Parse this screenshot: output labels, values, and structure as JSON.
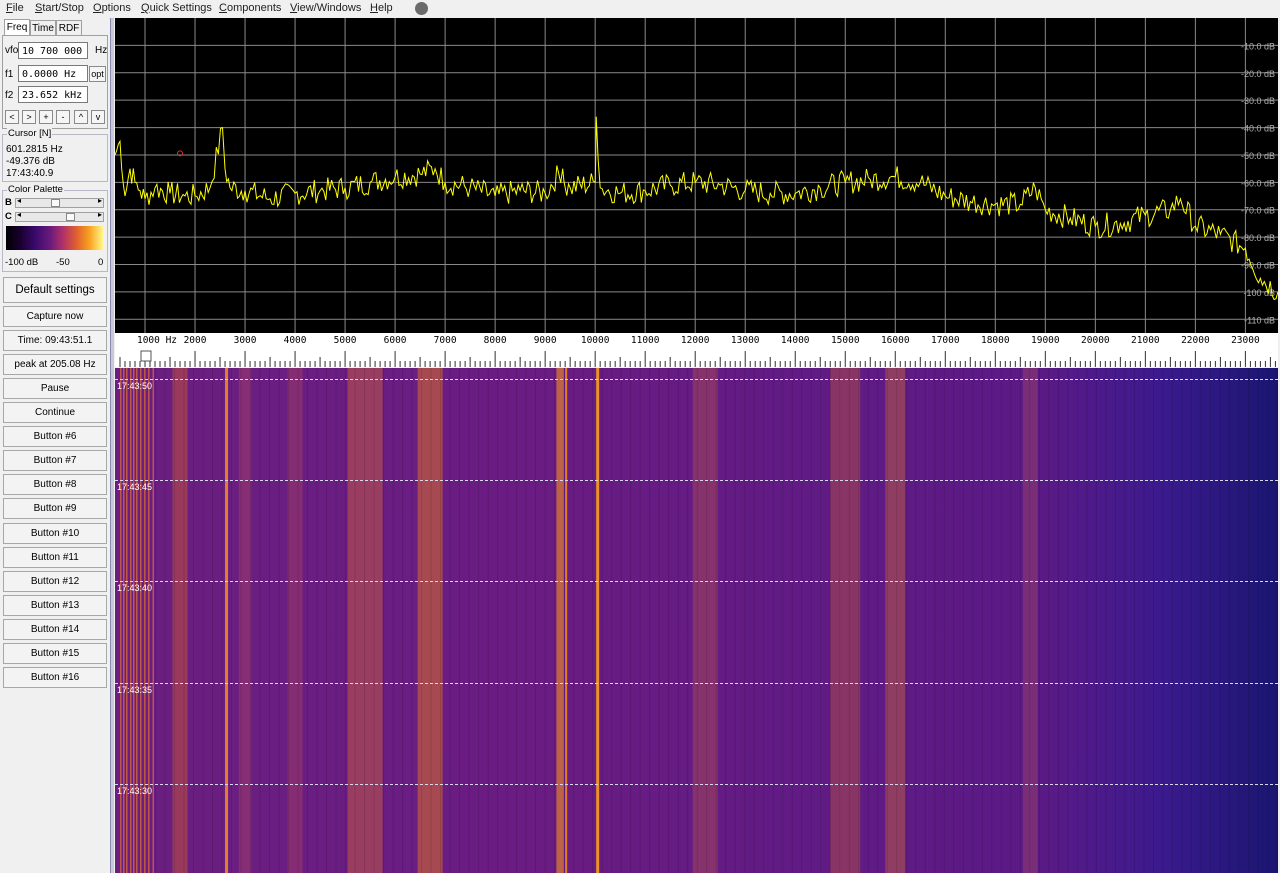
{
  "menu": [
    {
      "label": "File",
      "ul": "F"
    },
    {
      "label": "Start/Stop",
      "ul": "S"
    },
    {
      "label": "Options",
      "ul": "O"
    },
    {
      "label": "Quick Settings",
      "ul": "Q"
    },
    {
      "label": "Components",
      "ul": "C"
    },
    {
      "label": "View/Windows",
      "ul": "V"
    },
    {
      "label": "Help",
      "ul": "H"
    }
  ],
  "tabs": [
    "Freq",
    "Time",
    "RDF"
  ],
  "freq": {
    "vfo_label": "vfo",
    "vfo_value": "10 700 000",
    "vfo_unit": "Hz",
    "f1_label": "f1",
    "f1_value": "0.0000 Hz",
    "f1_btn": "opt",
    "f2_label": "f2",
    "f2_value": "23.652 kHz",
    "nav": [
      "<",
      ">",
      "+",
      "-",
      "^",
      "v"
    ]
  },
  "cursor": {
    "title": "Cursor [N]",
    "freq": "601.2815 Hz",
    "level": "-49.376 dB",
    "time": "17:43:40.9"
  },
  "palette": {
    "title": "Color Palette",
    "b_label": "B",
    "c_label": "C",
    "min": "-100 dB",
    "mid": "-50",
    "max": "0"
  },
  "buttons": {
    "default": "Default settings",
    "capture": "Capture now",
    "time": "Time:  09:43:51.1",
    "peak": "peak at 205.08 Hz",
    "pause": "Pause",
    "cont": "Continue",
    "b6": "Button #6",
    "b7": "Button #7",
    "b8": "Button #8",
    "b9": "Button #9",
    "b10": "Button #10",
    "b11": "Button #11",
    "b12": "Button #12",
    "b13": "Button #13",
    "b14": "Button #14",
    "b15": "Button #15",
    "b16": "Button #16"
  },
  "chart_data": {
    "type": "line",
    "title": "",
    "xlabel": "Hz",
    "ylabel": "dB",
    "xlim": [
      400,
      23652
    ],
    "ylim": [
      -115,
      0
    ],
    "x_ticks": [
      "1000 Hz",
      "2000",
      "3000",
      "4000",
      "5000",
      "6000",
      "7000",
      "8000",
      "9000",
      "10000",
      "11000",
      "12000",
      "13000",
      "14000",
      "15000",
      "16000",
      "17000",
      "18000",
      "19000",
      "20000",
      "21000",
      "22000",
      "23000"
    ],
    "y_ticks": [
      "-10.0 dB",
      "-20.0 dB",
      "-30.0 dB",
      "-40.0 dB",
      "-50.0 dB",
      "-60.0 dB",
      "-70.0 dB",
      "-80.0 dB",
      "-90.0 dB",
      "-100 dB",
      "-110 dB"
    ],
    "series": [
      {
        "color": "#ffff00",
        "values_x": [
          400,
          500,
          600,
          700,
          800,
          900,
          1000,
          1200,
          1500,
          1800,
          2000,
          2300,
          2550,
          2600,
          2700,
          3000,
          3500,
          4000,
          4500,
          5000,
          5500,
          6000,
          6500,
          6800,
          7000,
          7500,
          8000,
          8500,
          9000,
          9350,
          9400,
          9500,
          10000,
          10020,
          10100,
          10500,
          11000,
          11500,
          12000,
          12500,
          13000,
          13500,
          14000,
          14500,
          15000,
          15500,
          16000,
          16500,
          17000,
          17500,
          18000,
          18500,
          18800,
          19000,
          19500,
          20000,
          20500,
          21000,
          21500,
          21700,
          22000,
          22500,
          23000,
          23300,
          23652
        ],
        "values_y": [
          -50,
          -45,
          -65,
          -55,
          -60,
          -63,
          -66,
          -62,
          -64,
          -65,
          -65,
          -62,
          -40,
          -55,
          -62,
          -63,
          -66,
          -64,
          -63,
          -62,
          -60,
          -58,
          -57,
          -55,
          -60,
          -62,
          -65,
          -63,
          -64,
          -55,
          -62,
          -62,
          -60,
          -36,
          -62,
          -64,
          -63,
          -61,
          -60,
          -61,
          -63,
          -64,
          -64,
          -62,
          -60,
          -59,
          -58,
          -60,
          -65,
          -67,
          -68,
          -68,
          -62,
          -70,
          -73,
          -76,
          -75,
          -72,
          -70,
          -66,
          -76,
          -79,
          -84,
          -95,
          -100
        ]
      }
    ],
    "waterfall_timestamps": [
      "17:43:50",
      "17:43:45",
      "17:43:40",
      "17:43:35",
      "17:43:30"
    ]
  }
}
